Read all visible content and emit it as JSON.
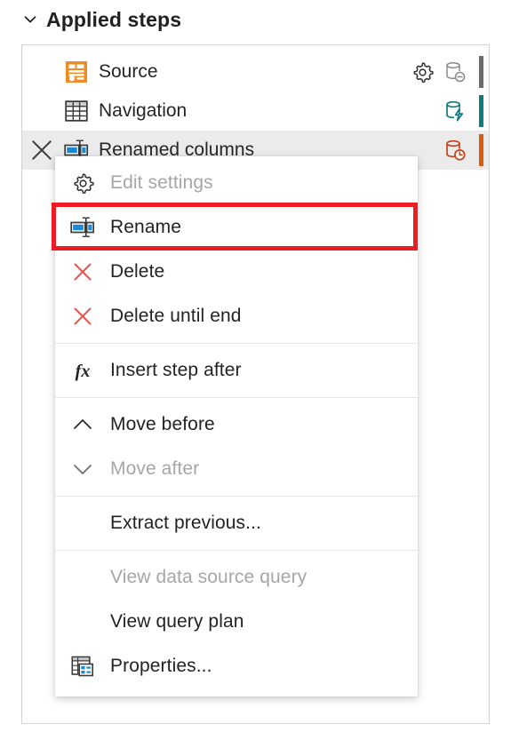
{
  "header": {
    "title": "Applied steps",
    "chevron_icon": "chevron-down-icon",
    "expanded": true
  },
  "colors": {
    "highlight_red": "#ed1c24",
    "selected_row_bg": "#ebebeb",
    "source_icon_orange": "#ef8c23",
    "rename_icon_blue": "#1b8ad6",
    "teal_bar": "#0f7b7f",
    "orange_bar": "#d95a0b",
    "gray_bar": "#6b6b6b",
    "delete_x_red": "#e8554f",
    "panel_border": "#d2d2d2",
    "text": "#232323",
    "text_disabled": "#a6a6a6"
  },
  "steps": [
    {
      "label": "Source",
      "icon": "source-table-icon",
      "has_delete": false,
      "has_gear": true,
      "gear_icon": "gear-icon",
      "db_icon": "database-minus-icon",
      "db_icon_color": "#8a8a8a",
      "bar_color": "#6b6b6b",
      "selected": false
    },
    {
      "label": "Navigation",
      "icon": "grid-table-icon",
      "has_delete": false,
      "has_gear": false,
      "db_icon": "database-bolt-icon",
      "db_icon_color": "#0f7b7f",
      "bar_color": "#0f7b7f",
      "selected": false
    },
    {
      "label": "Renamed columns",
      "icon": "rename-columns-icon",
      "has_delete": true,
      "delete_icon": "close-x-icon",
      "has_gear": false,
      "db_icon": "database-clock-icon",
      "db_icon_color": "#c4421a",
      "bar_color": "#d95a0b",
      "selected": true
    }
  ],
  "context_menu": {
    "highlighted_item": "Rename",
    "items": [
      {
        "label": "Edit settings",
        "icon": "gear-icon",
        "disabled": true,
        "highlighted": false,
        "separator_after": false
      },
      {
        "label": "Rename",
        "icon": "rename-columns-icon",
        "disabled": false,
        "highlighted": true,
        "separator_after": false
      },
      {
        "label": "Delete",
        "icon": "delete-x-icon",
        "disabled": false,
        "highlighted": false,
        "separator_after": false
      },
      {
        "label": "Delete until end",
        "icon": "delete-x-icon",
        "disabled": false,
        "highlighted": false,
        "separator_after": true
      },
      {
        "label": "Insert step after",
        "icon": "fx-icon",
        "disabled": false,
        "highlighted": false,
        "separator_after": true
      },
      {
        "label": "Move before",
        "icon": "chevron-up-icon",
        "disabled": false,
        "highlighted": false,
        "separator_after": false
      },
      {
        "label": "Move after",
        "icon": "chevron-down-icon",
        "disabled": true,
        "highlighted": false,
        "separator_after": true
      },
      {
        "label": "Extract previous...",
        "icon": "none",
        "disabled": false,
        "highlighted": false,
        "separator_after": true
      },
      {
        "label": "View data source query",
        "icon": "none",
        "disabled": true,
        "highlighted": false,
        "separator_after": false
      },
      {
        "label": "View query plan",
        "icon": "none",
        "disabled": false,
        "highlighted": false,
        "separator_after": false
      },
      {
        "label": "Properties...",
        "icon": "properties-table-icon",
        "disabled": false,
        "highlighted": false,
        "separator_after": false
      }
    ]
  }
}
